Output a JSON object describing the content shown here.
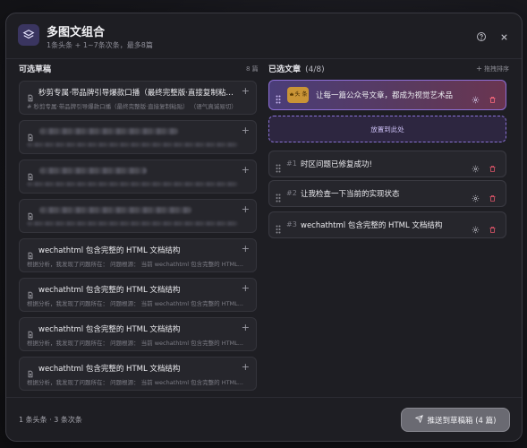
{
  "dialog": {
    "title": "多图文组合",
    "subtitle": "1条头条 + 1~7条次条，最多8篇",
    "icon": "layers-icon",
    "help_icon": "help-circle-icon",
    "close_icon": "close-icon"
  },
  "available": {
    "heading": "可选草稿",
    "count": "8 篇",
    "items": [
      {
        "title": "秒剪专属·带品牌引导爆款口播（最终完整版·直接复制粘贴）",
        "snippet": "# 秒剪专属·带品牌引导爆款口播（最终完整版·直接复制粘贴）   （语气真诚易切）",
        "blurred": false
      },
      {
        "title": "",
        "snippet": "",
        "blurred": true
      },
      {
        "title": "",
        "snippet": "",
        "blurred": true
      },
      {
        "title": "",
        "snippet": "",
        "blurred": true
      },
      {
        "title": "wechathtml 包含完整的 HTML 文档结构",
        "snippet": "根据分析，我发现了问题所在：   问题根源：   当前 wechathtml 包含完整的 HTML...",
        "blurred": false
      },
      {
        "title": "wechathtml 包含完整的 HTML 文档结构",
        "snippet": "根据分析，我发现了问题所在：   问题根源：   当前 wechathtml 包含完整的 HTML...",
        "blurred": false
      },
      {
        "title": "wechathtml 包含完整的 HTML 文档结构",
        "snippet": "根据分析，我发现了问题所在：   问题根源：   当前 wechathtml 包含完整的 HTML...",
        "blurred": false
      },
      {
        "title": "wechathtml 包含完整的 HTML 文档结构",
        "snippet": "根据分析，我发现了问题所在：   问题根源：   当前 wechathtml 包含完整的 HTML...",
        "blurred": false
      }
    ]
  },
  "selected": {
    "heading": "已选文章",
    "count": "(4/8)",
    "sort_hint": "拖拽排序",
    "headline": {
      "thumb": "头 条",
      "title": "让每一篇公众号文章，都成为视觉艺术品"
    },
    "dropzone": "放置到此处",
    "items": [
      {
        "index": "#1",
        "title": "时区问题已修复成功!"
      },
      {
        "index": "#2",
        "title": "让我检查一下当前的实现状态"
      },
      {
        "index": "#3",
        "title": "wechathtml 包含完整的 HTML 文档结构"
      }
    ]
  },
  "footer": {
    "info": "1 条头条 · 3 条次条",
    "push_label": "推送到草稿箱 (4 篇)"
  },
  "colors": {
    "accent": "#8d6fd6",
    "danger": "#e0566a",
    "bg": "#1e1e23"
  }
}
